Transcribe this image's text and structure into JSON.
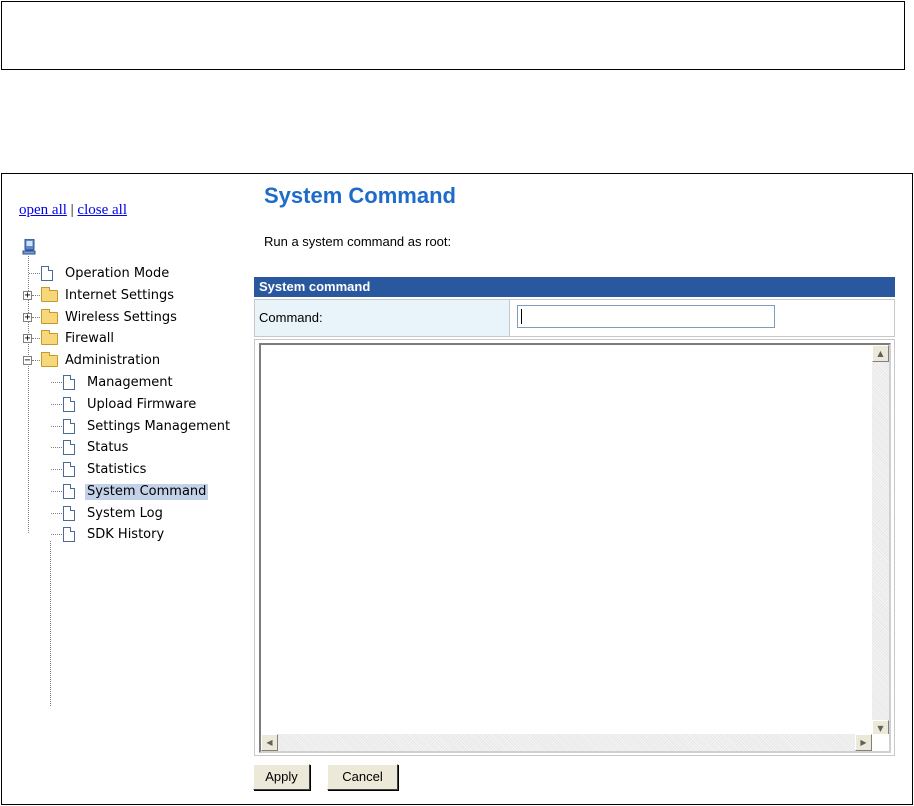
{
  "tree": {
    "open_all": "open all",
    "separator": "|",
    "close_all": "close all",
    "items": [
      {
        "label": "Operation Mode"
      },
      {
        "label": "Internet Settings"
      },
      {
        "label": "Wireless Settings"
      },
      {
        "label": "Firewall"
      },
      {
        "label": "Administration"
      },
      {
        "label": "Management"
      },
      {
        "label": "Upload Firmware"
      },
      {
        "label": "Settings Management"
      },
      {
        "label": "Status"
      },
      {
        "label": "Statistics"
      },
      {
        "label": "System Command"
      },
      {
        "label": "System Log"
      },
      {
        "label": "SDK History"
      }
    ],
    "selected": "System Command",
    "expand_plus": "+",
    "collapse_minus": "−"
  },
  "content": {
    "title": "System Command",
    "description": "Run a system command as root:",
    "table_header": "System command",
    "command_label": "Command:",
    "command_value": "",
    "output_text": ""
  },
  "buttons": {
    "apply": "Apply",
    "cancel": "Cancel"
  },
  "colors": {
    "title": "#1f6bc9",
    "table_header_bg": "#29589e",
    "label_bg": "#e8f4fa",
    "selected_bg": "#c3d2e8"
  },
  "icons": {
    "root": "computer-icon",
    "leaf": "document-icon",
    "folder": "folder-icon",
    "folder_open": "folder-open-icon",
    "scroll_up": "scroll-up-arrow-icon",
    "scroll_down": "scroll-down-arrow-icon",
    "scroll_left": "scroll-left-arrow-icon",
    "scroll_right": "scroll-right-arrow-icon"
  }
}
